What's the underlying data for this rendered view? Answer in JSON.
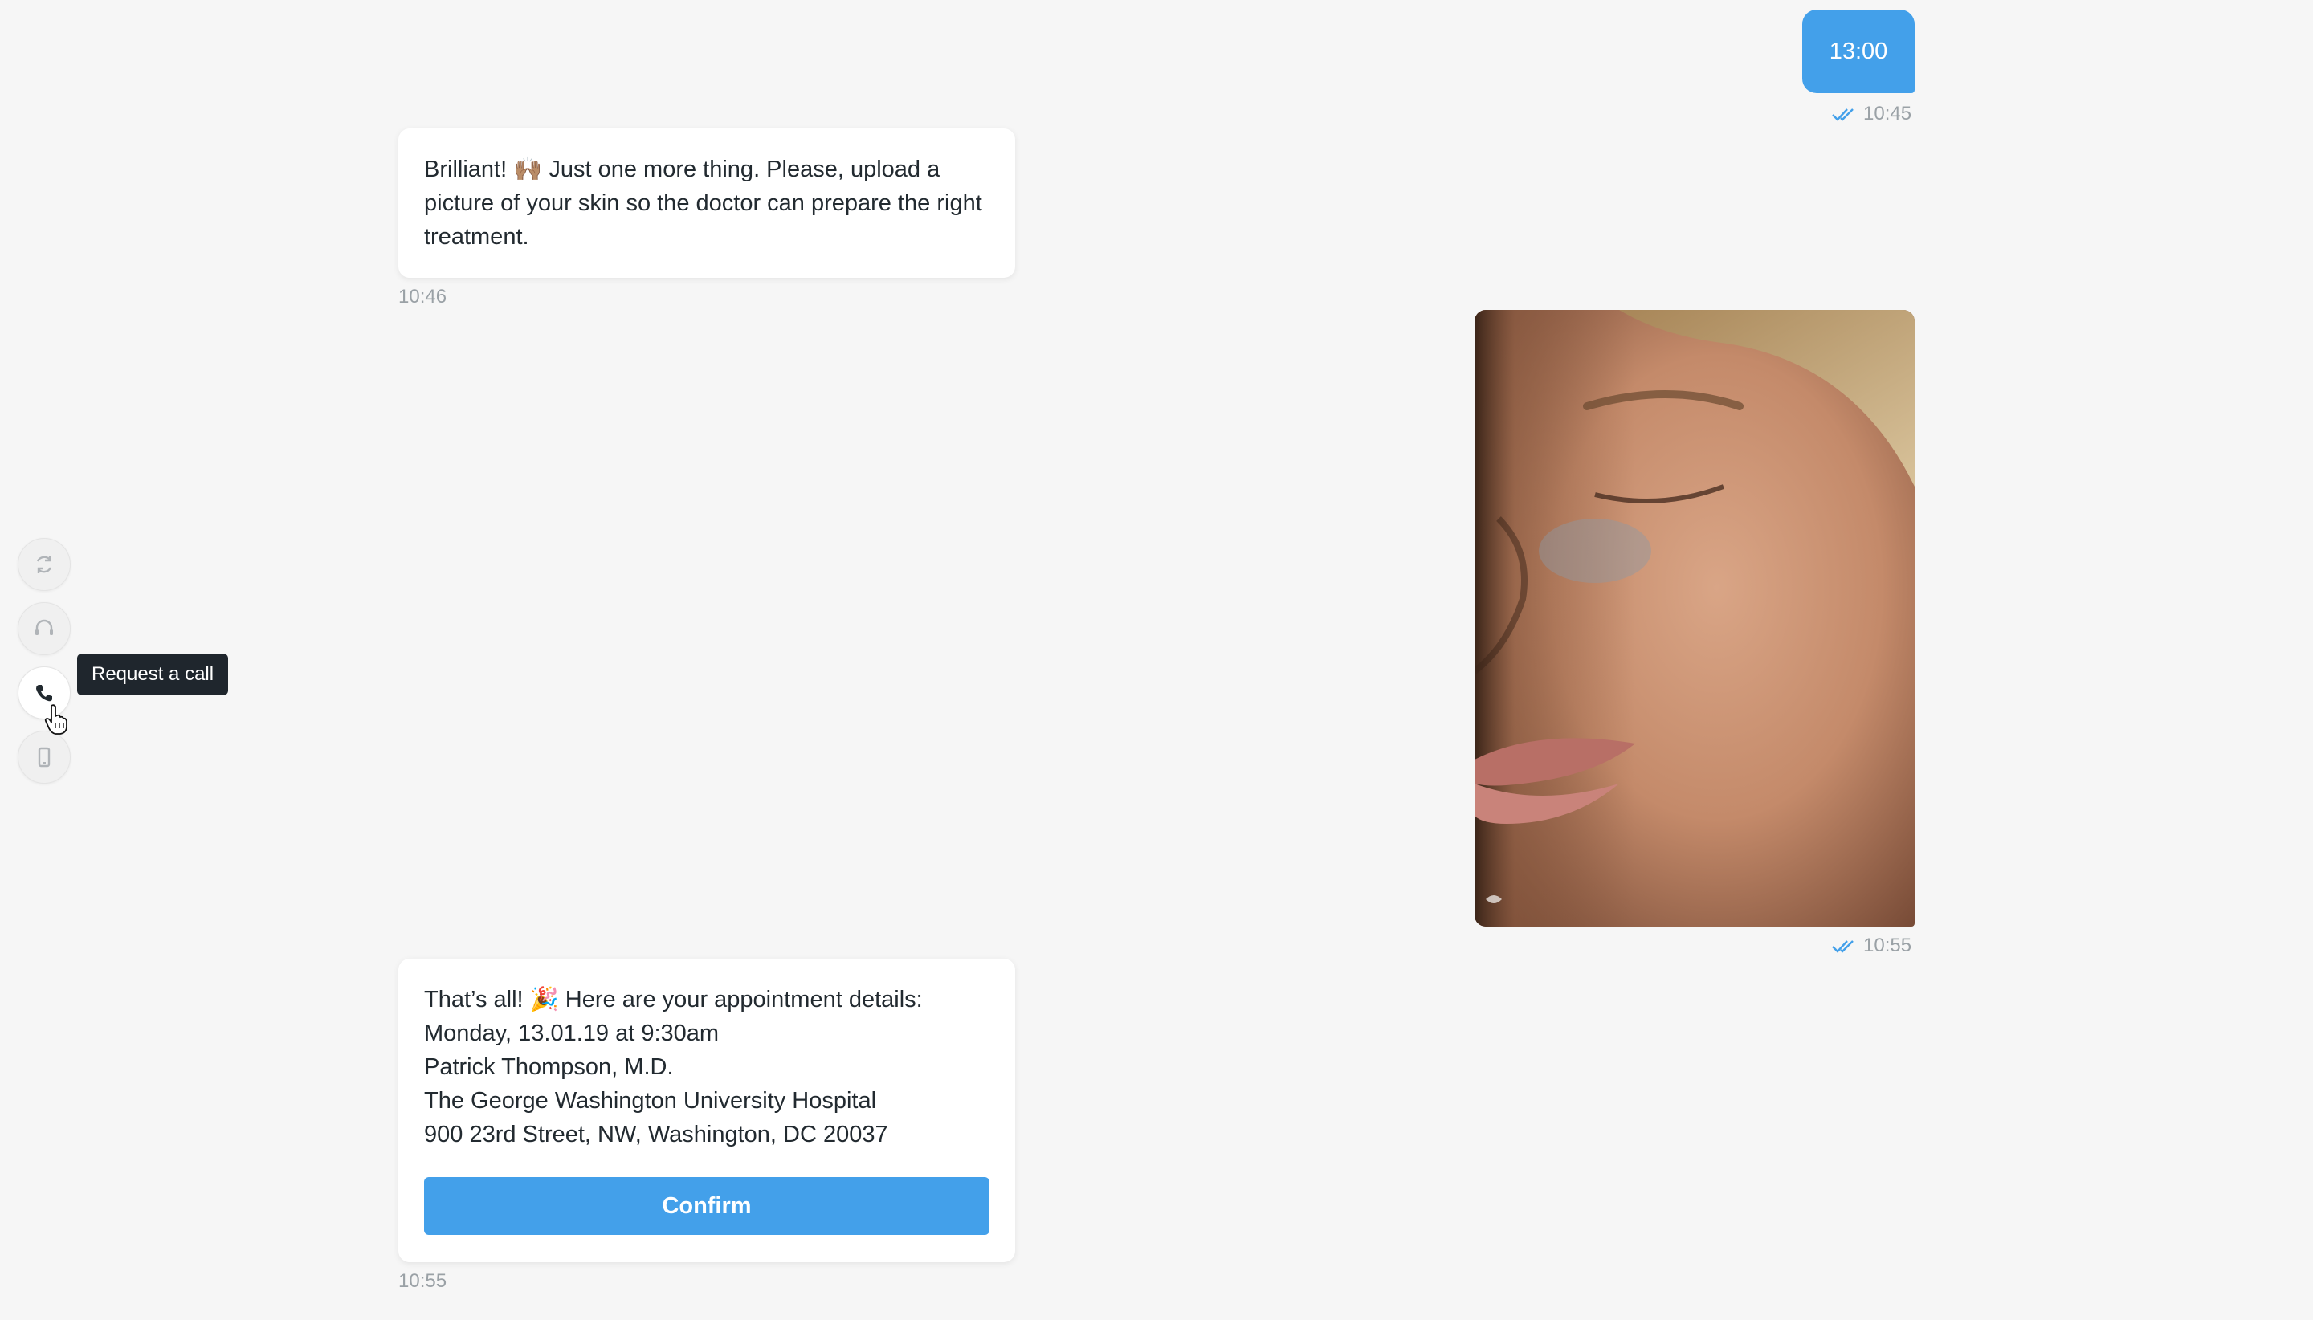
{
  "messages": {
    "out1": {
      "text": "13:00",
      "time": "10:45"
    },
    "bot1": {
      "text": "Brilliant! 🙌🏽 Just one more thing. Please, upload a picture of your skin so the doctor can prepare the right treatment.",
      "time": "10:46"
    },
    "photo": {
      "time": "10:55",
      "icon": "face-photo"
    },
    "bot2": {
      "lines": [
        "That’s all! 🎉 Here are your appointment details:",
        "Monday, 13.01.19 at 9:30am",
        "Patrick Thompson, M.D.",
        "The George Washington University Hospital",
        "900 23rd Street, NW, Washington, DC 20037"
      ],
      "confirm_label": "Confirm",
      "time": "10:55"
    }
  },
  "tools": [
    {
      "name": "refresh-icon"
    },
    {
      "name": "headset-icon"
    },
    {
      "name": "phone-icon"
    },
    {
      "name": "mobile-icon"
    }
  ],
  "tooltip": "Request a call",
  "colors": {
    "accent": "#43a0ea",
    "background": "#f6f6f6",
    "tooltip": "#1f262d"
  }
}
